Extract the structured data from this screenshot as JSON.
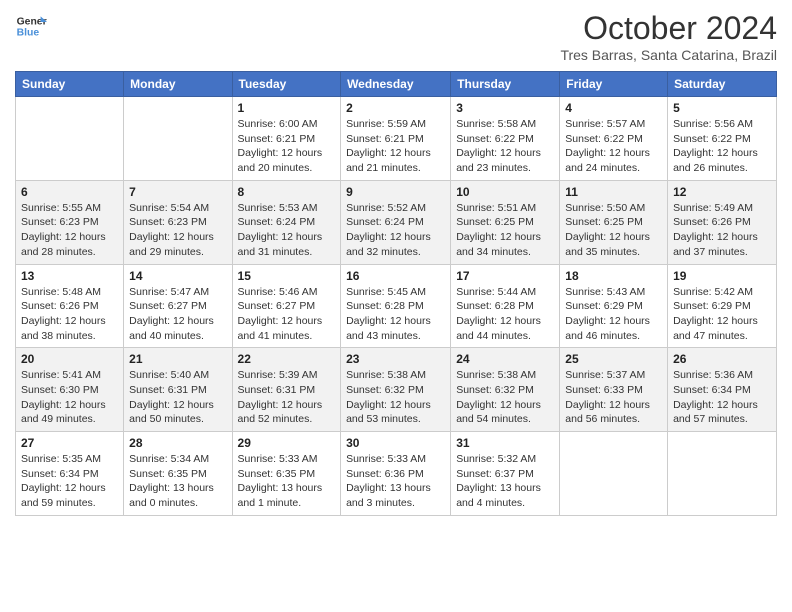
{
  "logo": {
    "line1": "General",
    "line2": "Blue"
  },
  "title": "October 2024",
  "location": "Tres Barras, Santa Catarina, Brazil",
  "days_of_week": [
    "Sunday",
    "Monday",
    "Tuesday",
    "Wednesday",
    "Thursday",
    "Friday",
    "Saturday"
  ],
  "weeks": [
    [
      {
        "day": "",
        "info": ""
      },
      {
        "day": "",
        "info": ""
      },
      {
        "day": "1",
        "info": "Sunrise: 6:00 AM\nSunset: 6:21 PM\nDaylight: 12 hours and 20 minutes."
      },
      {
        "day": "2",
        "info": "Sunrise: 5:59 AM\nSunset: 6:21 PM\nDaylight: 12 hours and 21 minutes."
      },
      {
        "day": "3",
        "info": "Sunrise: 5:58 AM\nSunset: 6:22 PM\nDaylight: 12 hours and 23 minutes."
      },
      {
        "day": "4",
        "info": "Sunrise: 5:57 AM\nSunset: 6:22 PM\nDaylight: 12 hours and 24 minutes."
      },
      {
        "day": "5",
        "info": "Sunrise: 5:56 AM\nSunset: 6:22 PM\nDaylight: 12 hours and 26 minutes."
      }
    ],
    [
      {
        "day": "6",
        "info": "Sunrise: 5:55 AM\nSunset: 6:23 PM\nDaylight: 12 hours and 28 minutes."
      },
      {
        "day": "7",
        "info": "Sunrise: 5:54 AM\nSunset: 6:23 PM\nDaylight: 12 hours and 29 minutes."
      },
      {
        "day": "8",
        "info": "Sunrise: 5:53 AM\nSunset: 6:24 PM\nDaylight: 12 hours and 31 minutes."
      },
      {
        "day": "9",
        "info": "Sunrise: 5:52 AM\nSunset: 6:24 PM\nDaylight: 12 hours and 32 minutes."
      },
      {
        "day": "10",
        "info": "Sunrise: 5:51 AM\nSunset: 6:25 PM\nDaylight: 12 hours and 34 minutes."
      },
      {
        "day": "11",
        "info": "Sunrise: 5:50 AM\nSunset: 6:25 PM\nDaylight: 12 hours and 35 minutes."
      },
      {
        "day": "12",
        "info": "Sunrise: 5:49 AM\nSunset: 6:26 PM\nDaylight: 12 hours and 37 minutes."
      }
    ],
    [
      {
        "day": "13",
        "info": "Sunrise: 5:48 AM\nSunset: 6:26 PM\nDaylight: 12 hours and 38 minutes."
      },
      {
        "day": "14",
        "info": "Sunrise: 5:47 AM\nSunset: 6:27 PM\nDaylight: 12 hours and 40 minutes."
      },
      {
        "day": "15",
        "info": "Sunrise: 5:46 AM\nSunset: 6:27 PM\nDaylight: 12 hours and 41 minutes."
      },
      {
        "day": "16",
        "info": "Sunrise: 5:45 AM\nSunset: 6:28 PM\nDaylight: 12 hours and 43 minutes."
      },
      {
        "day": "17",
        "info": "Sunrise: 5:44 AM\nSunset: 6:28 PM\nDaylight: 12 hours and 44 minutes."
      },
      {
        "day": "18",
        "info": "Sunrise: 5:43 AM\nSunset: 6:29 PM\nDaylight: 12 hours and 46 minutes."
      },
      {
        "day": "19",
        "info": "Sunrise: 5:42 AM\nSunset: 6:29 PM\nDaylight: 12 hours and 47 minutes."
      }
    ],
    [
      {
        "day": "20",
        "info": "Sunrise: 5:41 AM\nSunset: 6:30 PM\nDaylight: 12 hours and 49 minutes."
      },
      {
        "day": "21",
        "info": "Sunrise: 5:40 AM\nSunset: 6:31 PM\nDaylight: 12 hours and 50 minutes."
      },
      {
        "day": "22",
        "info": "Sunrise: 5:39 AM\nSunset: 6:31 PM\nDaylight: 12 hours and 52 minutes."
      },
      {
        "day": "23",
        "info": "Sunrise: 5:38 AM\nSunset: 6:32 PM\nDaylight: 12 hours and 53 minutes."
      },
      {
        "day": "24",
        "info": "Sunrise: 5:38 AM\nSunset: 6:32 PM\nDaylight: 12 hours and 54 minutes."
      },
      {
        "day": "25",
        "info": "Sunrise: 5:37 AM\nSunset: 6:33 PM\nDaylight: 12 hours and 56 minutes."
      },
      {
        "day": "26",
        "info": "Sunrise: 5:36 AM\nSunset: 6:34 PM\nDaylight: 12 hours and 57 minutes."
      }
    ],
    [
      {
        "day": "27",
        "info": "Sunrise: 5:35 AM\nSunset: 6:34 PM\nDaylight: 12 hours and 59 minutes."
      },
      {
        "day": "28",
        "info": "Sunrise: 5:34 AM\nSunset: 6:35 PM\nDaylight: 13 hours and 0 minutes."
      },
      {
        "day": "29",
        "info": "Sunrise: 5:33 AM\nSunset: 6:35 PM\nDaylight: 13 hours and 1 minute."
      },
      {
        "day": "30",
        "info": "Sunrise: 5:33 AM\nSunset: 6:36 PM\nDaylight: 13 hours and 3 minutes."
      },
      {
        "day": "31",
        "info": "Sunrise: 5:32 AM\nSunset: 6:37 PM\nDaylight: 13 hours and 4 minutes."
      },
      {
        "day": "",
        "info": ""
      },
      {
        "day": "",
        "info": ""
      }
    ]
  ]
}
